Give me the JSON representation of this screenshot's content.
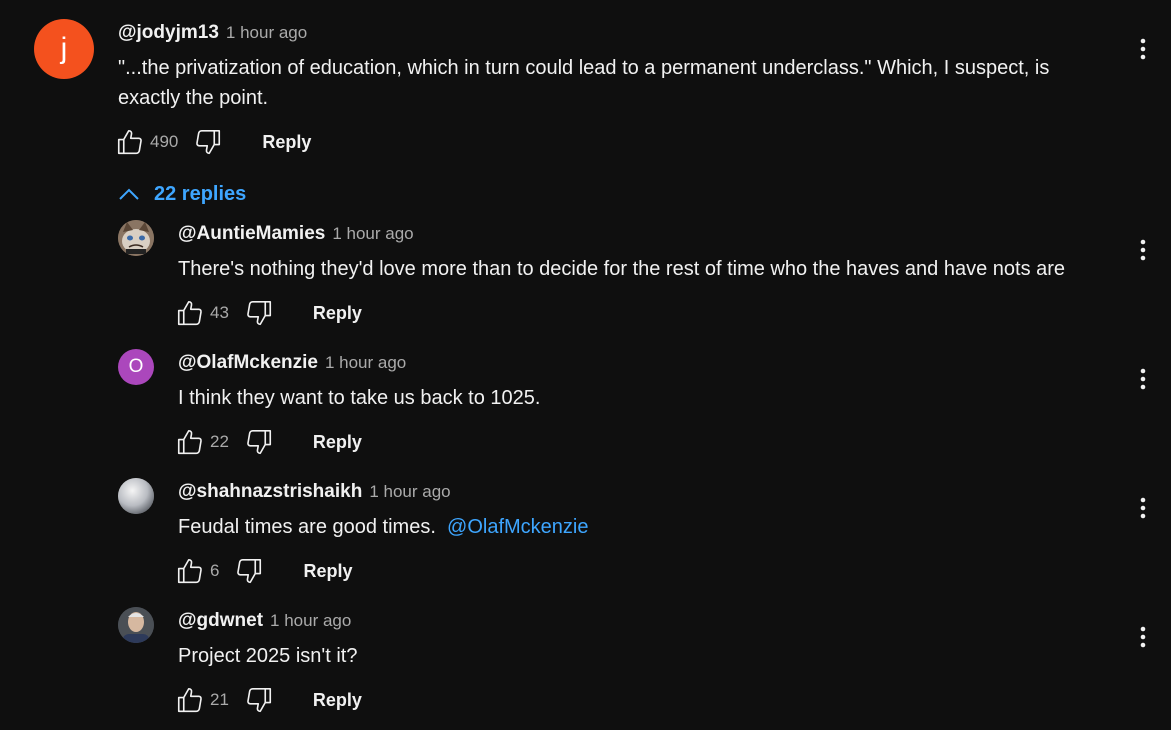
{
  "colors": {
    "background": "#0f0f0f",
    "link": "#3ea6ff",
    "muted": "#aaaaaa",
    "text": "#f1f1f1"
  },
  "top_comment": {
    "avatar_letter": "j",
    "avatar_color": "#f4511e",
    "author": "@jodyjm13",
    "time": "1 hour ago",
    "text_line1": "\"...the privatization of education, which in turn could lead to a permanent underclass.\" Which, I suspect, is",
    "text_line2": "exactly the point.",
    "likes": "490",
    "reply_label": "Reply"
  },
  "replies_toggle": {
    "label": "22 replies",
    "icon": "chevron-up-icon"
  },
  "replies": [
    {
      "author": "@AuntieMamies",
      "time": "1 hour ago",
      "text": "There's nothing they'd love more than to decide for the rest of time who the haves and have nots are",
      "likes": "43",
      "reply_label": "Reply",
      "avatar": "cat-photo"
    },
    {
      "author": "@OlafMckenzie",
      "time": "1 hour ago",
      "text": "I think they want to take us back to 1025.",
      "likes": "22",
      "reply_label": "Reply",
      "avatar_letter": "O",
      "avatar_color": "#ab47bc"
    },
    {
      "author": "@shahnazstrishaikh",
      "time": "1 hour ago",
      "text": "Feudal times are good times.",
      "mention": "@OlafMckenzie",
      "likes": "6",
      "reply_label": "Reply",
      "avatar": "gray-sphere"
    },
    {
      "author": "@gdwnet",
      "time": "1 hour ago",
      "text": "Project 2025 isn't it?",
      "likes": "21",
      "reply_label": "Reply",
      "avatar": "person-photo"
    }
  ]
}
